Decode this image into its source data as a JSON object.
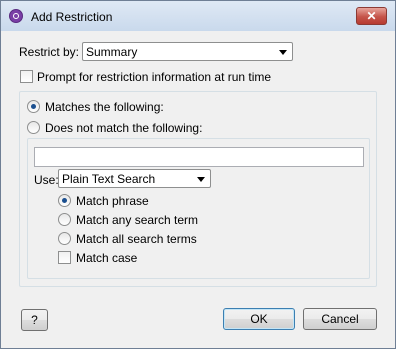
{
  "window": {
    "title": "Add Restriction",
    "close_glyph": "✕",
    "icon": "app-logo-icon"
  },
  "restrict_by": {
    "label": "Restrict by:",
    "value": "Summary"
  },
  "prompt_checkbox": {
    "label": "Prompt for restriction information at run time",
    "checked": false
  },
  "match_mode": {
    "matches_label": "Matches the following:",
    "not_match_label": "Does not match the following:",
    "selected": "matches"
  },
  "search": {
    "text_value": "",
    "use_label": "Use:",
    "use_value": "Plain Text Search",
    "options": [
      "Match phrase",
      "Match any search term",
      "Match all search terms"
    ],
    "selected_option": "Match phrase",
    "match_case_label": "Match case",
    "match_case_checked": false
  },
  "buttons": {
    "help": "?",
    "ok": "OK",
    "cancel": "Cancel"
  }
}
